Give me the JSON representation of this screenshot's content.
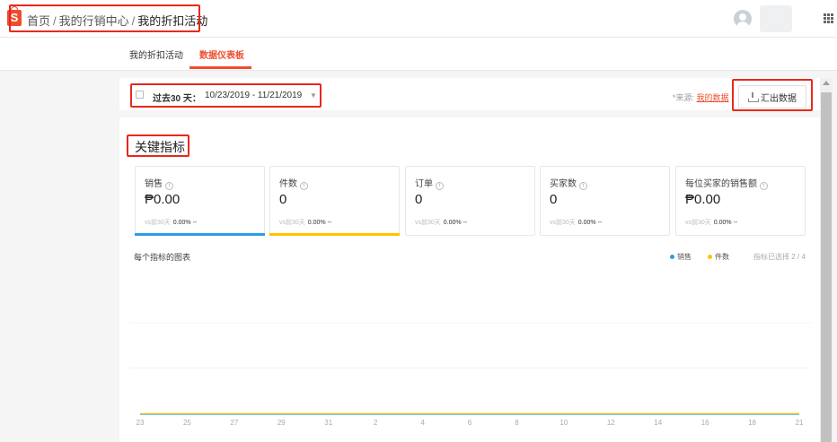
{
  "header": {
    "logo_letter": "S",
    "breadcrumb": {
      "home": "首页",
      "marketing": "我的行销中心",
      "current": "我的折扣活动",
      "separator": "/"
    }
  },
  "tabs": [
    {
      "label": "我的折扣活动",
      "active": false
    },
    {
      "label": "数据仪表板",
      "active": true
    }
  ],
  "filter": {
    "period_label": "过去30 天：",
    "date_range": "10/23/2019 - 11/21/2019",
    "source_prefix": "*来源:",
    "source_link": "我的数据",
    "export_label": "汇出数据"
  },
  "key_metrics": {
    "title": "关键指标",
    "compare_label": "vs前30天",
    "cards": [
      {
        "title": "销售",
        "value": "₱0.00",
        "change": "0.00% --",
        "bar_color": "#2d9de8"
      },
      {
        "title": "件数",
        "value": "0",
        "change": "0.00% --",
        "bar_color": "#ffc400"
      },
      {
        "title": "订单",
        "value": "0",
        "change": "0.00% --",
        "bar_color": ""
      },
      {
        "title": "买家数",
        "value": "0",
        "change": "0.00% --",
        "bar_color": ""
      },
      {
        "title": "每位买家的销售额",
        "value": "₱0.00",
        "change": "0.00% --",
        "bar_color": ""
      }
    ]
  },
  "chart_data": {
    "type": "line",
    "title": "每个指标的图表",
    "categories": [
      "23",
      "25",
      "27",
      "29",
      "31",
      "2",
      "4",
      "6",
      "8",
      "10",
      "12",
      "14",
      "16",
      "18",
      "21"
    ],
    "series": [
      {
        "name": "销售",
        "color": "#2d9de8",
        "values": [
          0,
          0,
          0,
          0,
          0,
          0,
          0,
          0,
          0,
          0,
          0,
          0,
          0,
          0,
          0
        ]
      },
      {
        "name": "件数",
        "color": "#ffc400",
        "values": [
          0,
          0,
          0,
          0,
          0,
          0,
          0,
          0,
          0,
          0,
          0,
          0,
          0,
          0,
          0
        ]
      }
    ],
    "selected_text": "指标已选择 2 / 4",
    "grid": true
  }
}
